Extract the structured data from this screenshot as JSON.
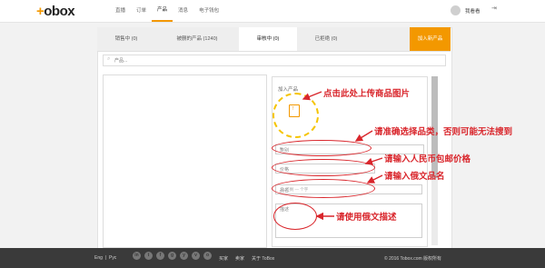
{
  "header": {
    "logo_mark": "+",
    "logo_text": "obox",
    "nav": [
      "直播",
      "订单",
      "产品",
      "消息",
      "电子钱包"
    ],
    "active_nav": "产品",
    "username": "我看看",
    "logout_icon": "logout-icon"
  },
  "tabs": [
    "销售中 (0)",
    "被删的产品 (1240)",
    "审核中 (0)",
    "已拒绝 (0)"
  ],
  "active_tab": "审核中 (0)",
  "add_product_label": "加入新产品",
  "search": {
    "placeholder": "产品..."
  },
  "form": {
    "title": "加入产品",
    "category_placeholder": "类别",
    "price_placeholder": "价格",
    "name_placeholder": "品名",
    "name_counter": "30 还剩 — 个字",
    "desc_placeholder": "描述"
  },
  "annotations": {
    "upload_hint": "点击此处上传商品图片",
    "category_hint": "请准确选择品类，否则可能无法搜到",
    "price_hint": "请输入人民币包邮价格",
    "name_hint": "请输入俄文品名",
    "desc_hint": "请使用俄文描述"
  },
  "footer": {
    "lang_eng": "Eng",
    "lang_sep": "|",
    "lang_rus": "Рус",
    "social": [
      "in",
      "t",
      "f",
      "g",
      "y",
      "v",
      "o"
    ],
    "links": [
      "买家",
      "卖家",
      "关于 ToBox"
    ],
    "copyright": "© 2016 Tobox.com 版权所有"
  },
  "colors": {
    "accent": "#f39800",
    "annotation": "#d9262c",
    "footer_bg": "#3a3a3a"
  }
}
